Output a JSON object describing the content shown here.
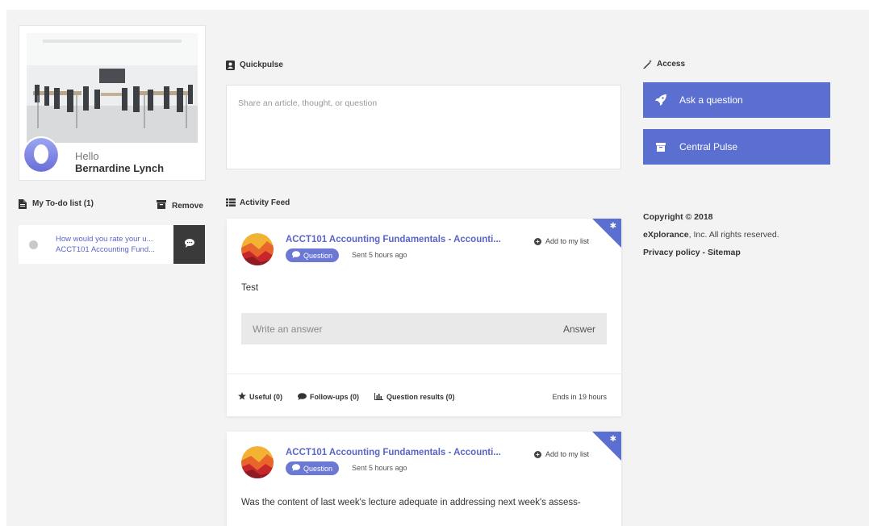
{
  "profile": {
    "greeting": "Hello",
    "name": "Bernardine Lynch"
  },
  "todo": {
    "title": "My To-do list (1)",
    "remove_label": "Remove",
    "items": [
      {
        "line1": "How would you rate your u...",
        "line2": "ACCT101 Accounting Fund..."
      }
    ]
  },
  "quickpulse": {
    "title": "Quickpulse",
    "placeholder": "Share an article, thought, or question"
  },
  "activity_feed": {
    "title": "Activity Feed",
    "cards": [
      {
        "course": "ACCT101 Accounting Fundamentals - Accounti...",
        "badge": "Question",
        "sent": "Sent 5 hours ago",
        "add_label": "Add to my list",
        "body": "Test",
        "answer_placeholder": "Write an answer",
        "answer_button": "Answer",
        "useful": "Useful (0)",
        "followups": "Follow-ups (0)",
        "results": "Question results (0)",
        "ends": "Ends in 19 hours"
      },
      {
        "course": "ACCT101 Accounting Fundamentals - Accounti...",
        "badge": "Question",
        "sent": "Sent 5 hours ago",
        "add_label": "Add to my list",
        "body": "Was the content of last week's lecture adequate in addressing next week's assess-"
      }
    ]
  },
  "access": {
    "title": "Access",
    "ask_label": "Ask a question",
    "central_label": "Central Pulse"
  },
  "footer": {
    "copyright": "Copyright © 2018",
    "company": "eXplorance",
    "rights": ", Inc. All rights reserved.",
    "privacy": "Privacy policy",
    "separator": " - ",
    "sitemap": "Sitemap"
  },
  "colors": {
    "accent": "#5b6fd0",
    "link": "#5a65c8",
    "page_bg": "#f3f3f4"
  }
}
